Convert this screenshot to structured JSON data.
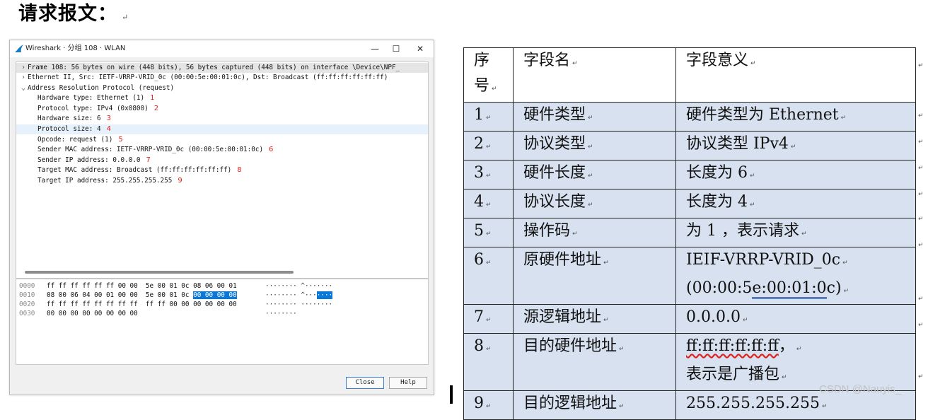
{
  "heading": {
    "text": "请求报文：",
    "mark": "↵"
  },
  "window": {
    "title": "Wireshark · 分组 108 · WLAN",
    "controls": {
      "minimize": "—",
      "maximize": "☐",
      "close": "✕"
    },
    "tree": [
      {
        "chev": "›",
        "text": "Frame 108: 56 bytes on wire (448 bits), 56 bytes captured (448 bits) on interface \\Device\\NPF_",
        "num": ""
      },
      {
        "chev": "›",
        "text": "Ethernet II, Src: IETF-VRRP-VRID_0c (00:00:5e:00:01:0c), Dst: Broadcast (ff:ff:ff:ff:ff:ff)",
        "num": ""
      },
      {
        "chev": "⌄",
        "text": "Address Resolution Protocol (request)",
        "num": ""
      },
      {
        "chev": "",
        "text": "Hardware type: Ethernet (1)",
        "num": "1"
      },
      {
        "chev": "",
        "text": "Protocol type: IPv4 (0x0800)",
        "num": "2"
      },
      {
        "chev": "",
        "text": "Hardware size: 6",
        "num": "3"
      },
      {
        "chev": "",
        "text": "Protocol size: 4",
        "num": "4"
      },
      {
        "chev": "",
        "text": "Opcode: request (1)",
        "num": "5"
      },
      {
        "chev": "",
        "text": "Sender MAC address: IETF-VRRP-VRID_0c (00:00:5e:00:01:0c)",
        "num": "6"
      },
      {
        "chev": "",
        "text": "Sender IP address: 0.0.0.0",
        "num": "7"
      },
      {
        "chev": "",
        "text": "Target MAC address: Broadcast (ff:ff:ff:ff:ff:ff)",
        "num": "8"
      },
      {
        "chev": "",
        "text": "Target IP address: 255.255.255.255",
        "num": "9"
      }
    ],
    "hex": [
      {
        "offset": "0000",
        "bytes_pre": "ff ff ff ff ff ff 00 00  5e 00 01 0c 08 06 00 01",
        "bytes_hl": "",
        "ascii_pre": "········ ^·······",
        "ascii_hl": ""
      },
      {
        "offset": "0010",
        "bytes_pre": "08 00 06 04 00 01 00 00  5e 00 01 0c ",
        "bytes_hl": "00 00 00 00",
        "ascii_pre": "········ ^···",
        "ascii_hl": "····"
      },
      {
        "offset": "0020",
        "bytes_pre": "ff ff ff ff ff ff ff ff  ff ff 00 00 00 00 00 00",
        "bytes_hl": "",
        "ascii_pre": "········ ········",
        "ascii_hl": ""
      },
      {
        "offset": "0030",
        "bytes_pre": "00 00 00 00 00 00 00 00",
        "bytes_hl": "",
        "ascii_pre": "········",
        "ascii_hl": ""
      }
    ],
    "buttons": {
      "close": "Close",
      "help": "Help"
    }
  },
  "table": {
    "headers": [
      {
        "line1": "序",
        "line2": "号",
        "mark": "↵"
      },
      {
        "text": "字段名",
        "mark": "↵"
      },
      {
        "text": "字段意义",
        "mark": "↵"
      }
    ],
    "rows": [
      {
        "no": "1",
        "name": "硬件类型",
        "meaning": "硬件类型为 Ethernet"
      },
      {
        "no": "2",
        "name": "协议类型",
        "meaning": "协议类型 IPv4"
      },
      {
        "no": "3",
        "name": "硬件长度",
        "meaning": "长度为 6"
      },
      {
        "no": "4",
        "name": "协议长度",
        "meaning": "长度为 4"
      },
      {
        "no": "5",
        "name": "操作码",
        "meaning": "为 1 ，表示请求"
      },
      {
        "no": "6",
        "name": "原硬件地址",
        "meaning_line1": "IEIF-VRRP-VRID_0c",
        "meaning_line2_a": "(00:00:5",
        "meaning_line2_b": "e:00:01:0",
        "meaning_line2_c": "c)"
      },
      {
        "no": "7",
        "name": "源逻辑地址",
        "meaning": "0.0.0.0"
      },
      {
        "no": "8",
        "name": "目的硬件地址",
        "meaning_line1_a": "ff:ff:ff:ff:ff:ff",
        "meaning_line1_b": "，",
        "meaning_line2": "表示是广播包"
      },
      {
        "no": "9",
        "name": "目的逻辑地址",
        "meaning": "255.255.255.255"
      }
    ],
    "paragraph_mark": "↵"
  },
  "watermark": "CSDN @Nauyis_"
}
